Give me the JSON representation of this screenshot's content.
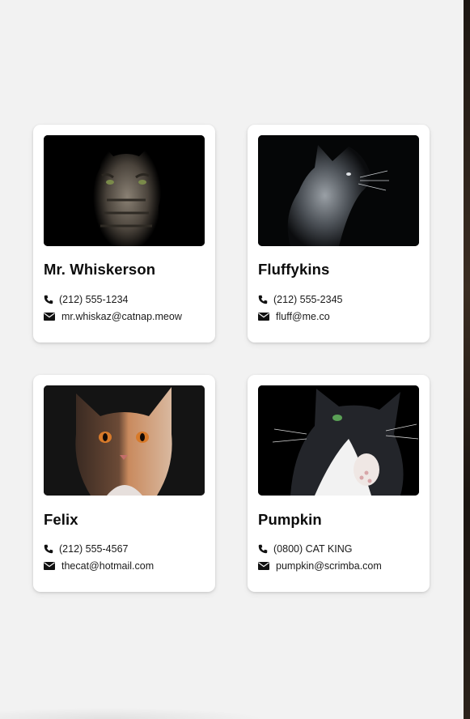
{
  "colors": {
    "page_background": "#f2f2f2",
    "card_background": "#ffffff",
    "text": "#0c0c0c"
  },
  "cards": [
    {
      "name": "Mr. Whiskerson",
      "phone": "(212) 555-1234",
      "email": "mr.whiskaz@catnap.meow",
      "photo": "tabby-kitten-photo"
    },
    {
      "name": "Fluffykins",
      "phone": "(212) 555-2345",
      "email": "fluff@me.co",
      "photo": "grey-longhair-cat-photo"
    },
    {
      "name": "Felix",
      "phone": "(212) 555-4567",
      "email": "thecat@hotmail.com",
      "photo": "calico-kitten-photo"
    },
    {
      "name": "Pumpkin",
      "phone": "(0800) CAT KING",
      "email": "pumpkin@scrimba.com",
      "photo": "tuxedo-cat-photo"
    }
  ],
  "icons": {
    "phone": "phone-icon",
    "email": "envelope-icon"
  }
}
